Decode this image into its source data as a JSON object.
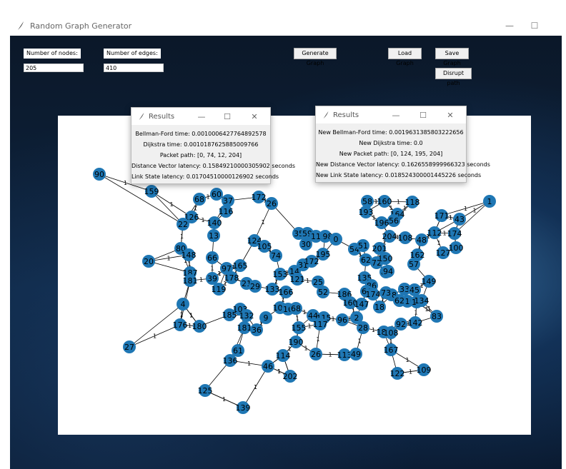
{
  "window": {
    "title": "Random Graph Generator",
    "minimize_glyph": "—",
    "maximize_glyph": "☐"
  },
  "controls": {
    "nodes_label": "Number of nodes:",
    "nodes_value": "205",
    "edges_label": "Number of edges:",
    "edges_value": "410",
    "generate_label": "Generate Graph",
    "load_label": "Load Graph",
    "save_label": "Save Graph",
    "disrupt_label": "Disrupt path"
  },
  "results1": {
    "title": "Results",
    "lines": [
      "Bellman-Ford time: 0.001000642776489257​8",
      "Dijkstra time: 0.0010187625885009766",
      "Packet path: [0, 74, 12, 204]",
      "Distance Vector latency: 0.15849210000305902 seconds",
      "Link State latency: 0.01704510000126902 seconds"
    ]
  },
  "results2": {
    "title": "Results",
    "lines": [
      "New Bellman-Ford time: 0.0019631385803222656",
      "New Dijkstra time: 0.0",
      "New Packet path: [0, 124, 195, 204]",
      "New Distance Vector latency: 0.1626558999966323 seconds",
      "New Link State latency: 0.018524300001445226 seconds"
    ]
  },
  "graph": {
    "node_color": "#1f77b4",
    "nodes": [
      [
        "90",
        139,
        244
      ],
      [
        "1",
        685,
        282
      ],
      [
        "159",
        212,
        268
      ],
      [
        "68",
        279,
        279
      ],
      [
        "60",
        303,
        272
      ],
      [
        "37",
        319,
        281
      ],
      [
        "172",
        362,
        276
      ],
      [
        "26",
        380,
        285
      ],
      [
        "43",
        643,
        307
      ],
      [
        "171",
        618,
        302
      ],
      [
        "174",
        636,
        327
      ],
      [
        "126",
        268,
        304
      ],
      [
        "22",
        256,
        314
      ],
      [
        "140",
        300,
        312
      ],
      [
        "116",
        316,
        296
      ],
      [
        "13",
        299,
        330
      ],
      [
        "164",
        556,
        300
      ],
      [
        "56",
        551,
        309
      ],
      [
        "193",
        512,
        297
      ],
      [
        "196",
        534,
        312
      ],
      [
        "58",
        514,
        282
      ],
      [
        "160",
        538,
        282
      ],
      [
        "118",
        577,
        283
      ],
      [
        "204",
        545,
        331
      ],
      [
        "108",
        567,
        333
      ],
      [
        "48",
        590,
        336
      ],
      [
        "112",
        608,
        326
      ],
      [
        "100",
        638,
        347
      ],
      [
        "127",
        620,
        354
      ],
      [
        "20",
        208,
        366
      ],
      [
        "80",
        253,
        348
      ],
      [
        "148",
        264,
        357
      ],
      [
        "66",
        297,
        361
      ],
      [
        "124",
        356,
        337
      ],
      [
        "105",
        370,
        345
      ],
      [
        "74",
        386,
        358
      ],
      [
        "35",
        418,
        327
      ],
      [
        "59",
        430,
        327
      ],
      [
        "198",
        455,
        331
      ],
      [
        "30",
        428,
        342
      ],
      [
        "11",
        442,
        331
      ],
      [
        "0",
        470,
        335
      ],
      [
        "195",
        452,
        356
      ],
      [
        "31",
        424,
        371
      ],
      [
        "172b",
        436,
        366
      ],
      [
        "54",
        496,
        349
      ],
      [
        "51",
        508,
        344
      ],
      [
        "201",
        531,
        348
      ],
      [
        "62",
        512,
        364
      ],
      [
        "72",
        527,
        368
      ],
      [
        "150",
        539,
        362
      ],
      [
        "57",
        579,
        370
      ],
      [
        "162",
        584,
        357
      ],
      [
        "85",
        540,
        381
      ],
      [
        "94",
        543,
        380
      ],
      [
        "39",
        297,
        390
      ],
      [
        "187",
        266,
        382
      ],
      [
        "181",
        266,
        393
      ],
      [
        "178",
        324,
        389
      ],
      [
        "97",
        317,
        376
      ],
      [
        "119",
        306,
        405
      ],
      [
        "165",
        336,
        372
      ],
      [
        "153",
        392,
        384
      ],
      [
        "14",
        412,
        380
      ],
      [
        "21",
        345,
        397
      ],
      [
        "29",
        357,
        401
      ],
      [
        "133",
        381,
        405
      ],
      [
        "166",
        400,
        409
      ],
      [
        "121",
        416,
        391
      ],
      [
        "25",
        445,
        395
      ],
      [
        "135",
        510,
        389
      ],
      [
        "149",
        600,
        394
      ],
      [
        "33",
        566,
        405
      ],
      [
        "45",
        580,
        406
      ],
      [
        "48b",
        548,
        413
      ],
      [
        "73",
        540,
        410
      ],
      [
        "86",
        520,
        400
      ],
      [
        "64",
        513,
        408
      ],
      [
        "174b",
        522,
        412
      ],
      [
        "4",
        256,
        426
      ],
      [
        "103",
        336,
        433
      ],
      [
        "185",
        321,
        441
      ],
      [
        "132",
        345,
        442
      ],
      [
        "9",
        372,
        445
      ],
      [
        "52",
        452,
        409
      ],
      [
        "186",
        482,
        412
      ],
      [
        "160b",
        490,
        424
      ],
      [
        "147",
        506,
        426
      ],
      [
        "110",
        570,
        422
      ],
      [
        "13b",
        583,
        423
      ],
      [
        "134",
        590,
        421
      ],
      [
        "62b",
        559,
        421
      ],
      [
        "18",
        531,
        430
      ],
      [
        "106",
        392,
        431
      ],
      [
        "16",
        403,
        433
      ],
      [
        "68b",
        414,
        432
      ],
      [
        "44",
        438,
        442
      ],
      [
        "115",
        453,
        445
      ],
      [
        "117",
        448,
        454
      ],
      [
        "96",
        479,
        448
      ],
      [
        "2",
        499,
        445
      ],
      [
        "28",
        508,
        459
      ],
      [
        "83",
        611,
        443
      ],
      [
        "92",
        561,
        454
      ],
      [
        "142",
        581,
        452
      ],
      [
        "181b",
        342,
        459
      ],
      [
        "36",
        359,
        462
      ],
      [
        "176",
        252,
        455
      ],
      [
        "180",
        279,
        457
      ],
      [
        "155",
        418,
        459
      ],
      [
        "188",
        537,
        465
      ],
      [
        "108b",
        547,
        466
      ],
      [
        "27",
        181,
        486
      ],
      [
        "190",
        414,
        479
      ],
      [
        "167",
        547,
        490
      ],
      [
        "61",
        333,
        491
      ],
      [
        "136",
        322,
        505
      ],
      [
        "114",
        396,
        498
      ],
      [
        "26b",
        442,
        496
      ],
      [
        "113",
        482,
        497
      ],
      [
        "49",
        498,
        496
      ],
      [
        "46",
        375,
        513
      ],
      [
        "202",
        406,
        527
      ],
      [
        "122",
        556,
        523
      ],
      [
        "109",
        593,
        518
      ],
      [
        "125",
        287,
        547
      ],
      [
        "139",
        340,
        571
      ]
    ],
    "edge_label": "1"
  }
}
